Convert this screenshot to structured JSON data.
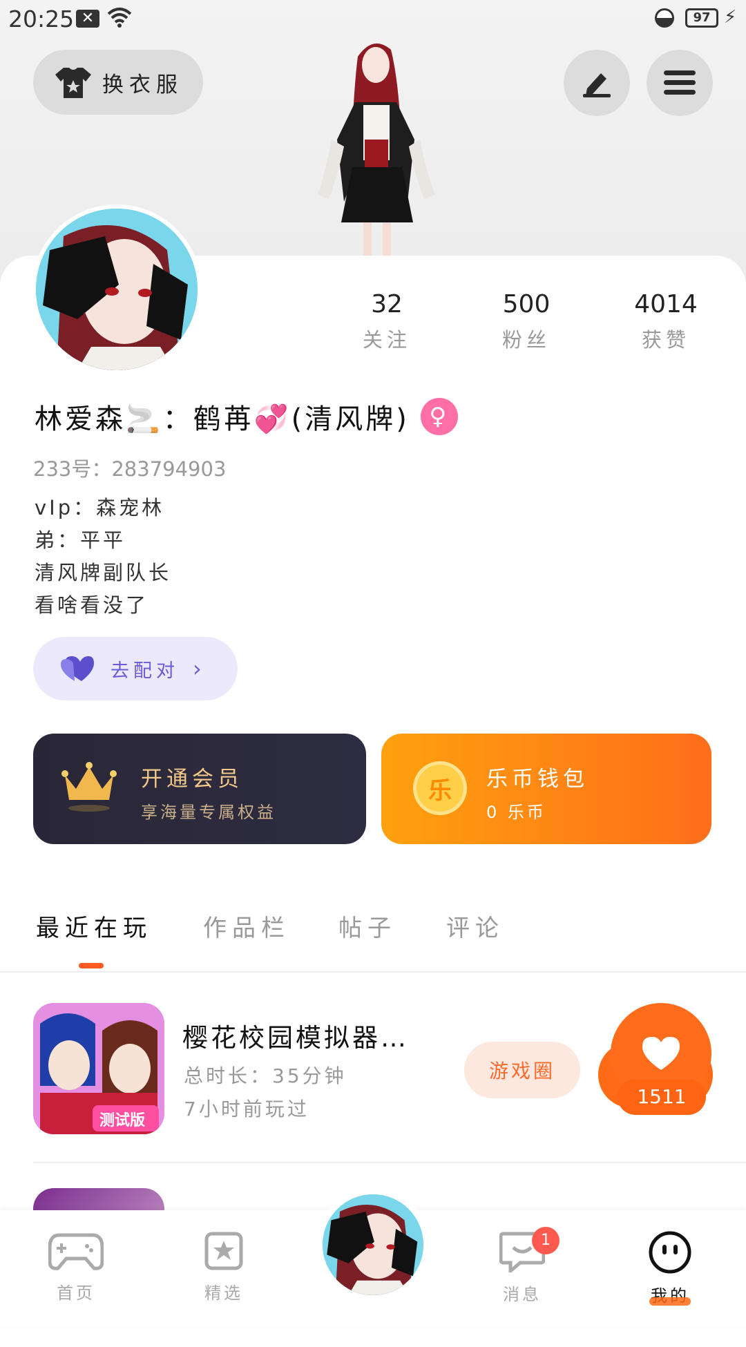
{
  "status_bar": {
    "time": "20:25",
    "battery": "97"
  },
  "header": {
    "outfit_label": "换衣服"
  },
  "profile": {
    "stats": [
      {
        "value": "32",
        "label": "关注"
      },
      {
        "value": "500",
        "label": "粉丝"
      },
      {
        "value": "4014",
        "label": "获赞"
      }
    ],
    "nickname": "林爱森🚬：鹤苒💞(清风牌)",
    "gender_symbol": "♀",
    "account_id": "233号：283794903",
    "bio_lines": [
      "vIp：森宠林",
      "弟：平平",
      "清风牌副队长",
      "看啥看没了"
    ],
    "match_label": "去配对"
  },
  "cards": {
    "vip": {
      "title": "开通会员",
      "subtitle": "享海量专属权益"
    },
    "wallet": {
      "icon_text": "乐",
      "title": "乐币钱包",
      "subtitle": "0 乐币"
    }
  },
  "tabs": [
    "最近在玩",
    "作品栏",
    "帖子",
    "评论"
  ],
  "games": [
    {
      "name": "樱花校园模拟器测...",
      "duration": "总时长：35分钟",
      "last_played": "7小时前玩过",
      "circle_label": "游戏圈",
      "likes": "1511",
      "icon_badge": "测试版"
    }
  ],
  "bottom_nav": {
    "items": [
      {
        "label": "首页",
        "icon": "gamepad-icon"
      },
      {
        "label": "精选",
        "icon": "star-bookmark-icon"
      },
      {
        "label": "消息",
        "icon": "chat-icon",
        "badge": "1"
      },
      {
        "label": "我的",
        "icon": "smiley-face-icon"
      }
    ]
  },
  "colors": {
    "accent": "#ff6a16",
    "match": "#6a5cd6",
    "gender": "#ff6fa5",
    "vip_text": "#f2c98a"
  }
}
